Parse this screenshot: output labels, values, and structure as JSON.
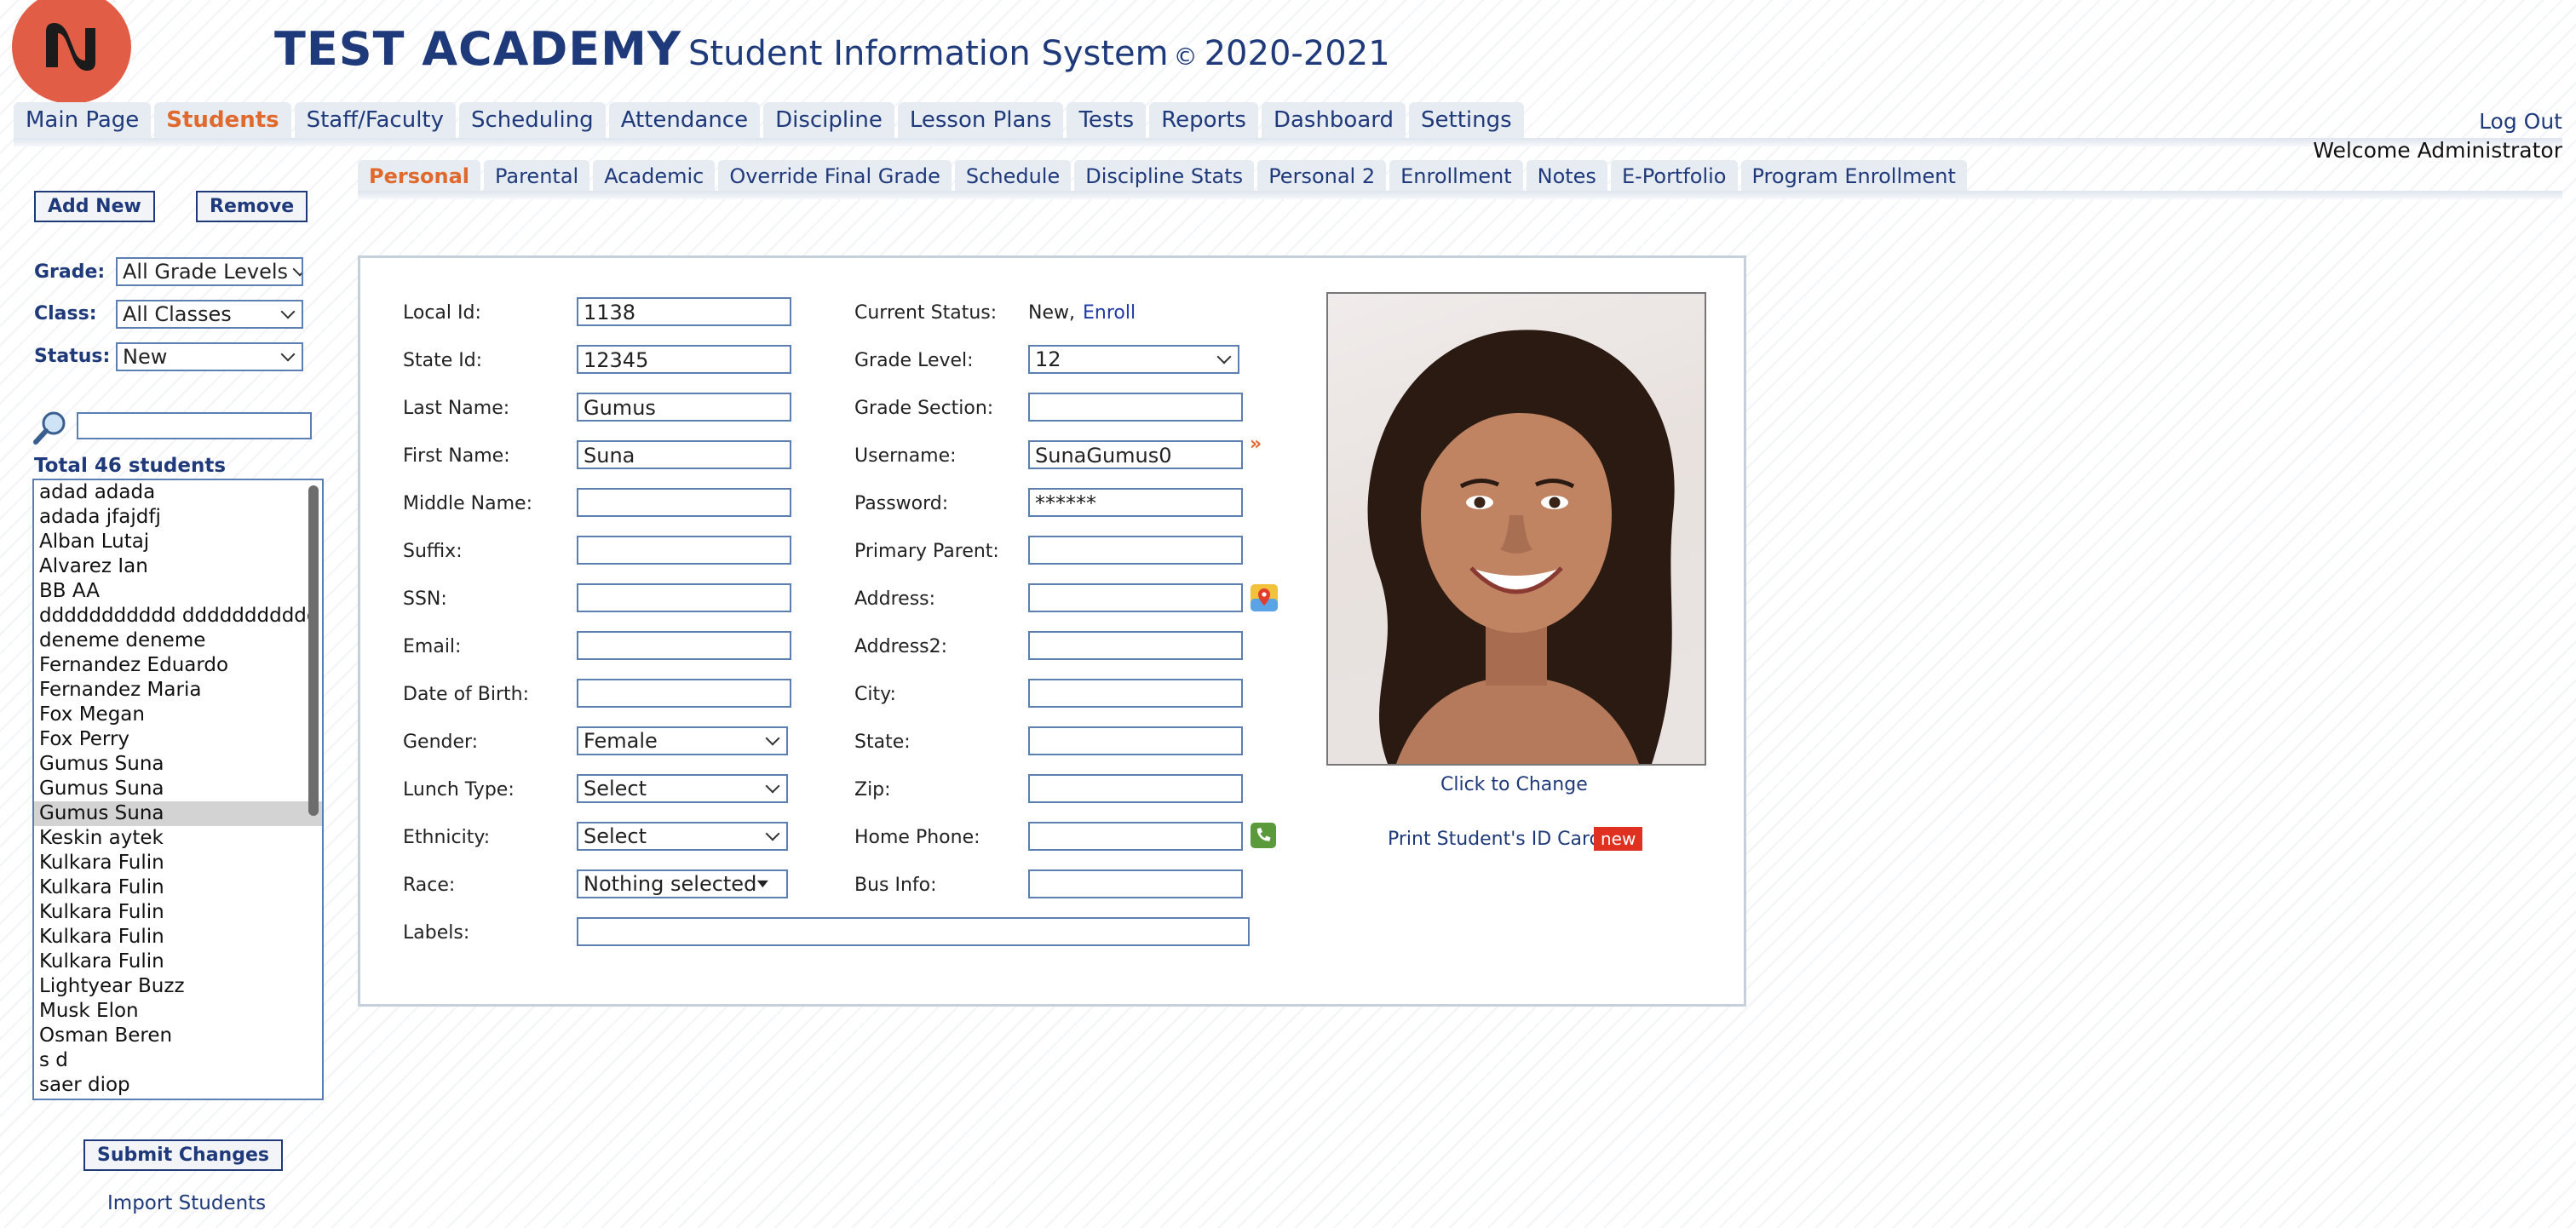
{
  "header": {
    "school": "TEST ACADEMY",
    "system": "Student Information System",
    "copyright": "©",
    "year": "2020-2021"
  },
  "topnav": {
    "tabs": [
      "Main Page",
      "Students",
      "Staff/Faculty",
      "Scheduling",
      "Attendance",
      "Discipline",
      "Lesson Plans",
      "Tests",
      "Reports",
      "Dashboard",
      "Settings"
    ],
    "active": "Students",
    "logout": "Log Out",
    "welcome": "Welcome Administrator"
  },
  "subnav": {
    "tabs": [
      "Personal",
      "Parental",
      "Academic",
      "Override Final Grade",
      "Schedule",
      "Discipline Stats",
      "Personal 2",
      "Enrollment",
      "Notes",
      "E-Portfolio",
      "Program Enrollment"
    ],
    "active": "Personal"
  },
  "sidebar": {
    "add_new": "Add New",
    "remove": "Remove",
    "grade_label": "Grade:",
    "grade_value": "All Grade Levels",
    "class_label": "Class:",
    "class_value": "All Classes",
    "status_label": "Status:",
    "status_value": "New",
    "search_value": "",
    "total": "Total 46 students",
    "students": [
      "adad adada",
      "adada jfajdfj",
      "Alban Lutaj",
      "Alvarez Ian",
      "BB AA",
      "ddddddddddd ddddddddddd",
      "deneme deneme",
      "Fernandez Eduardo",
      "Fernandez Maria",
      "Fox Megan",
      "Fox Perry",
      "Gumus Suna",
      "Gumus Suna",
      "Gumus Suna",
      "Keskin aytek",
      "Kulkara Fulin",
      "Kulkara Fulin",
      "Kulkara Fulin",
      "Kulkara Fulin",
      "Kulkara Fulin",
      "Lightyear Buzz",
      "Musk Elon",
      "Osman Beren",
      "s d",
      "saer diop"
    ],
    "selected_index": 13,
    "submit": "Submit Changes",
    "import": "Import Students"
  },
  "form": {
    "local_id": {
      "label": "Local Id:",
      "value": "1138"
    },
    "state_id": {
      "label": "State Id:",
      "value": "12345"
    },
    "last_name": {
      "label": "Last Name:",
      "value": "Gumus"
    },
    "first_name": {
      "label": "First Name:",
      "value": "Suna"
    },
    "middle_name": {
      "label": "Middle Name:",
      "value": ""
    },
    "suffix": {
      "label": "Suffix:",
      "value": ""
    },
    "ssn": {
      "label": "SSN:",
      "value": ""
    },
    "email": {
      "label": "Email:",
      "value": ""
    },
    "dob": {
      "label": "Date of Birth:",
      "value": ""
    },
    "gender": {
      "label": "Gender:",
      "value": "Female"
    },
    "lunch": {
      "label": "Lunch Type:",
      "value": "Select"
    },
    "ethnicity": {
      "label": "Ethnicity:",
      "value": "Select"
    },
    "race": {
      "label": "Race:",
      "value": "Nothing selected"
    },
    "labels": {
      "label": "Labels:",
      "value": ""
    },
    "current_status": {
      "label": "Current Status:",
      "value": "New,",
      "action": "Enroll"
    },
    "grade_level": {
      "label": "Grade Level:",
      "value": "12"
    },
    "grade_section": {
      "label": "Grade Section:",
      "value": ""
    },
    "username": {
      "label": "Username:",
      "value": "SunaGumus0"
    },
    "password": {
      "label": "Password:",
      "value": "******"
    },
    "primary_parent": {
      "label": "Primary Parent:",
      "value": ""
    },
    "address": {
      "label": "Address:",
      "value": ""
    },
    "address2": {
      "label": "Address2:",
      "value": ""
    },
    "city": {
      "label": "City:",
      "value": ""
    },
    "state": {
      "label": "State:",
      "value": ""
    },
    "zip": {
      "label": "Zip:",
      "value": ""
    },
    "home_phone": {
      "label": "Home Phone:",
      "value": ""
    },
    "bus_info": {
      "label": "Bus Info:",
      "value": ""
    }
  },
  "photo": {
    "change_link": "Click to Change",
    "print_id": "Print Student's ID Card",
    "new_badge": "new"
  },
  "colors": {
    "brand": "#1f3a7a",
    "accent": "#e0692e",
    "logo": "#e25d45",
    "badge": "#e03020"
  }
}
